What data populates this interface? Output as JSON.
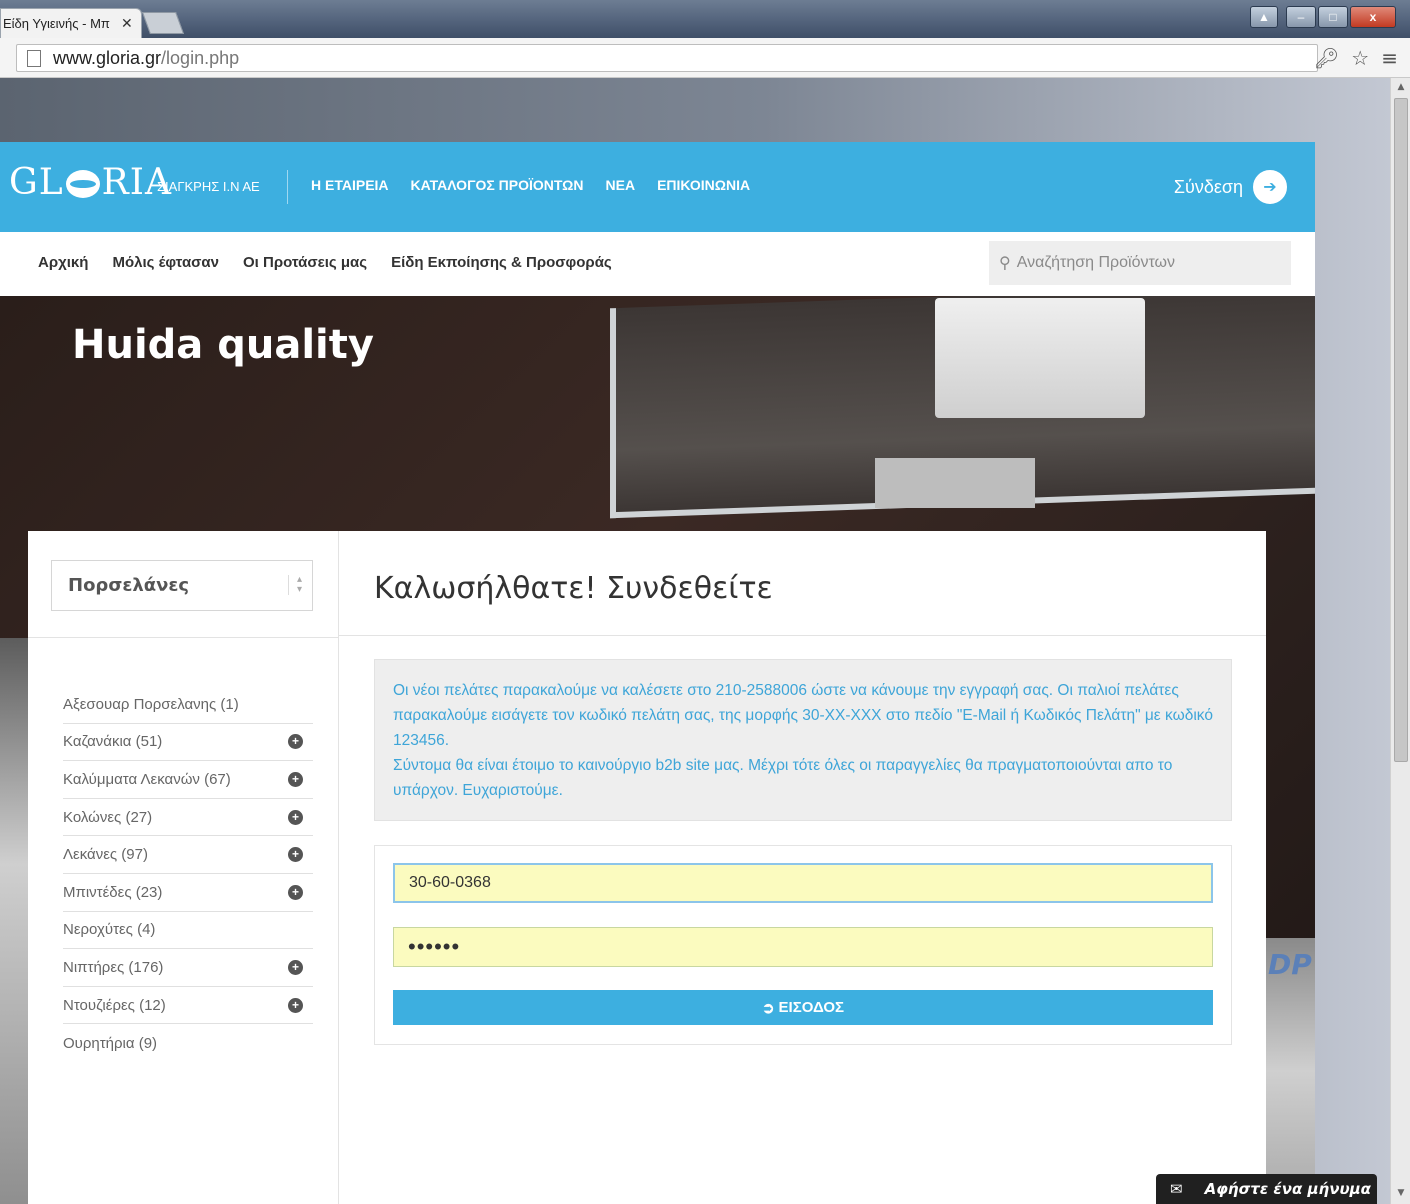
{
  "browser": {
    "tab_title": "Είδη Υγιεινής - Μπ",
    "tab_close": "✕",
    "url_host": "www.gloria.gr",
    "url_path": "/login.php",
    "window_buttons": {
      "user": "▲",
      "minimize": "–",
      "maximize": "□",
      "close": "x"
    }
  },
  "header": {
    "logo": {
      "left": "GL",
      "right": "RIA"
    },
    "company": "ΣΙΑΓΚΡΗΣ Ι.Ν ΑΕ",
    "nav": [
      "Η ΕΤΑΙΡΕΙΑ",
      "ΚΑΤΑΛΟΓΟΣ ΠΡΟΪΟΝΤΩΝ",
      "ΝΕΑ",
      "ΕΠΙΚΟΙΝΩΝΙΑ"
    ],
    "login_label": "Σύνδεση"
  },
  "subnav": {
    "links": [
      "Αρχική",
      "Μόλις έφτασαν",
      "Οι Προτάσεις μας",
      "Είδη Εκποίησης & Προσφοράς"
    ],
    "search_placeholder": "Αναζήτηση Προϊόντων"
  },
  "hero": {
    "title": "Huida quality",
    "watermark": "DP"
  },
  "sidebar": {
    "select_value": "Πορσελάνες",
    "categories": [
      {
        "label": "Αξεσουαρ Πορσελανης (1)",
        "expandable": false
      },
      {
        "label": "Καζανάκια (51)",
        "expandable": true
      },
      {
        "label": "Καλύμματα Λεκανών (67)",
        "expandable": true
      },
      {
        "label": "Κολώνες (27)",
        "expandable": true
      },
      {
        "label": "Λεκάνες (97)",
        "expandable": true
      },
      {
        "label": "Μπιντέδες (23)",
        "expandable": true
      },
      {
        "label": "Νεροχύτες (4)",
        "expandable": false
      },
      {
        "label": "Νιπτήρες (176)",
        "expandable": true
      },
      {
        "label": "Ντουζιέρες (12)",
        "expandable": true
      },
      {
        "label": "Ουρητήρια (9)",
        "expandable": false
      }
    ]
  },
  "main": {
    "welcome": "Καλωσήλθατε! Συνδεθείτε",
    "notice_line1": "Οι νέοι πελάτες παρακαλούμε να καλέσετε στο 210-2588006 ώστε να κάνουμε την εγγραφή σας. Οι παλιοί πελάτες παρακαλούμε εισάγετε τον κωδικό πελάτη σας, της μορφής 30-ΧΧ-ΧΧΧ στο πεδίο \"E-Mail ή Κωδικός Πελάτη\" με κωδικό 123456.",
    "notice_line2": "Σύντομα θα είναι έτοιμο το καινούργιο b2b site μας. Μέχρι τότε όλες οι παραγγελίες θα πραγματοποιούνται απο το υπάρχον. Ευχαριστούμε.",
    "username_value": "30-60-0368",
    "password_value": "••••••",
    "submit_label": "ΕΙΣΟΔΟΣ"
  },
  "chat": {
    "label": "Αφήστε ένα μήνυμα"
  }
}
